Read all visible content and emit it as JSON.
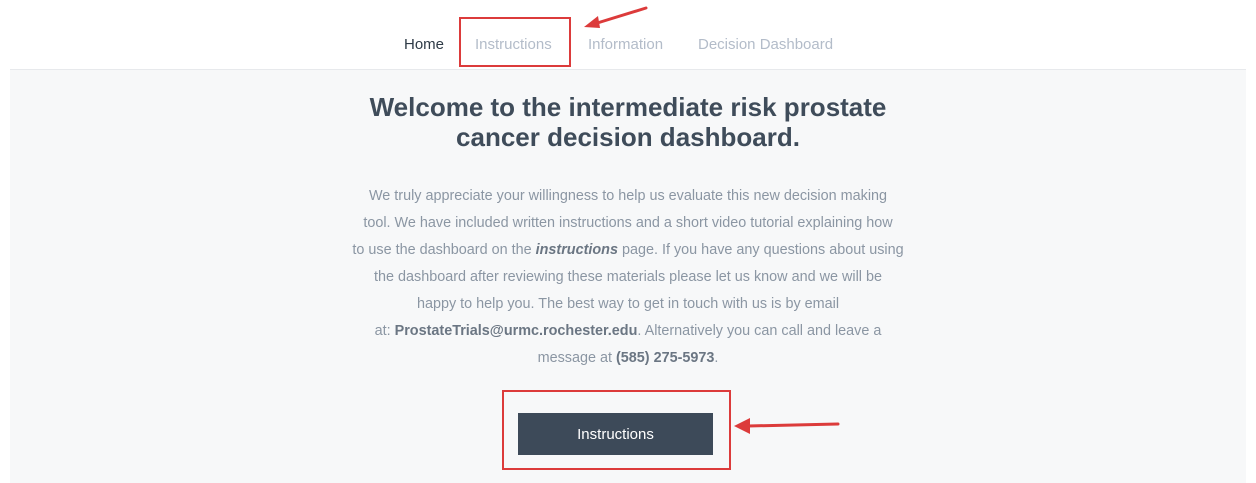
{
  "nav": {
    "items": [
      {
        "label": "Home",
        "active": true
      },
      {
        "label": "Instructions",
        "active": false
      },
      {
        "label": "Information",
        "active": false
      },
      {
        "label": "Decision Dashboard",
        "active": false
      }
    ]
  },
  "main": {
    "title_line1": "Welcome to the intermediate risk prostate",
    "title_line2": "cancer decision dashboard.",
    "intro": {
      "line1": "We truly appreciate your willingness to help us evaluate this new decision making",
      "line2": "tool. We have included written instructions and a short video tutorial explaining how",
      "line3_pre": "to use the dashboard on the ",
      "line3_em": "instructions",
      "line3_post": " page. If you have any questions about using",
      "line4": "the dashboard after reviewing these materials please let us know and we will be",
      "line5": "happy to help you. The best way to get in touch with us is by email",
      "line6_pre": "at: ",
      "email": "ProstateTrials@urmc.rochester.edu",
      "line6_post": ". Alternatively you can call and leave a",
      "line7_pre": "message at ",
      "phone": "(585) 275-5973",
      "line7_post": "."
    },
    "button_label": "Instructions"
  },
  "colors": {
    "annotation": "#dc3b3b",
    "button_bg": "#3d4a59",
    "title": "#3f4c5a",
    "body_text": "#8b96a3",
    "nav_active": "#2e3a46",
    "nav_inactive": "#b3bcc9"
  }
}
